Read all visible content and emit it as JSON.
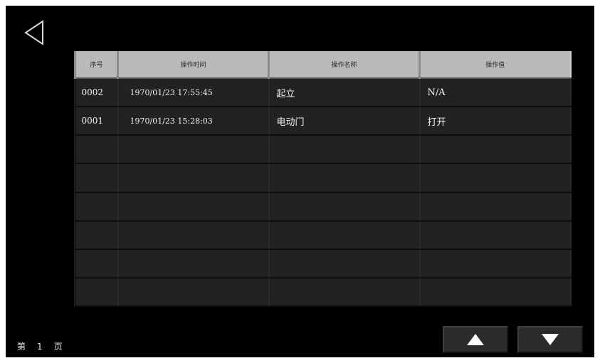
{
  "table": {
    "headers": [
      "序号",
      "操作时间",
      "操作名称",
      "操作值"
    ],
    "rows": [
      [
        "0002",
        "1970/01/23 17:55:45",
        "起立",
        "N/A"
      ],
      [
        "0001",
        "1970/01/23 15:28:03",
        "电动门",
        "打开"
      ],
      [
        "",
        "",
        "",
        ""
      ],
      [
        "",
        "",
        "",
        ""
      ],
      [
        "",
        "",
        "",
        ""
      ],
      [
        "",
        "",
        "",
        ""
      ],
      [
        "",
        "",
        "",
        ""
      ],
      [
        "",
        "",
        "",
        ""
      ]
    ]
  },
  "pagination": {
    "prefix": "第",
    "page": "1",
    "suffix": "页"
  },
  "icons": {
    "back": "back-triangle-icon",
    "up": "up-triangle-icon",
    "down": "down-triangle-icon"
  },
  "colors": {
    "header_bg": "#b9b9b9",
    "row_bg": "#222222",
    "screen_bg": "#000000"
  }
}
